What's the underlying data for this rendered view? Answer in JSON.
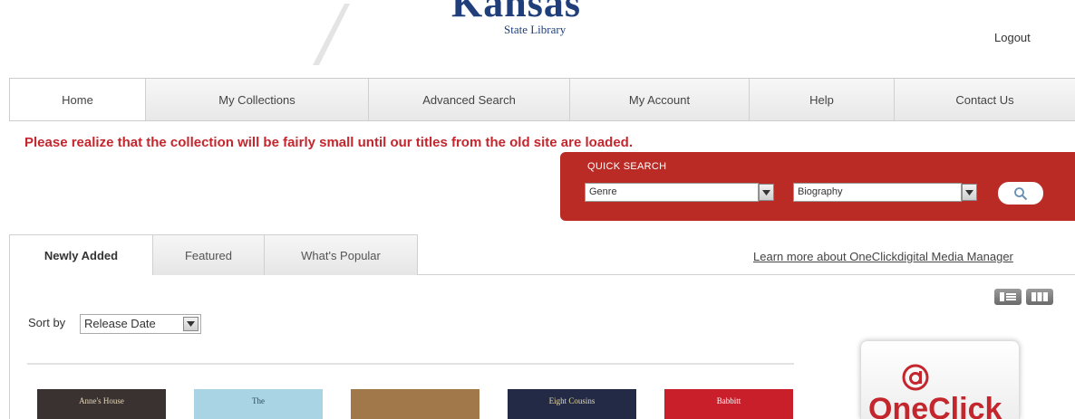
{
  "header": {
    "logo_word": "Kansas",
    "logo_sub": "State Library",
    "logout_label": "Logout"
  },
  "nav": {
    "items": [
      {
        "label": "Home",
        "active": true
      },
      {
        "label": "My Collections"
      },
      {
        "label": "Advanced Search"
      },
      {
        "label": "My Account"
      },
      {
        "label": "Help"
      },
      {
        "label": "Contact Us"
      }
    ]
  },
  "notice": "Please realize that the collection will be fairly small until our titles from the old site are loaded.",
  "quick_search": {
    "title": "QUICK SEARCH",
    "field_value": "Genre",
    "term_value": "Biography",
    "search_icon": "search-icon"
  },
  "tabs": [
    {
      "label": "Newly Added",
      "active": true
    },
    {
      "label": "Featured"
    },
    {
      "label": "What's Popular"
    }
  ],
  "learn_more_link": "Learn more about OneClickdigital Media Manager",
  "sort": {
    "label": "Sort by",
    "value": "Release Date"
  },
  "view_toggles": [
    "list-view-icon",
    "grid-view-icon"
  ],
  "books": [
    {
      "title": "Anne's House",
      "bg": "#3a3230",
      "fg": "#e8d8b8"
    },
    {
      "title": "The",
      "bg": "#a9d4e3",
      "fg": "#2c4a60"
    },
    {
      "title": "",
      "bg": "#a0784a",
      "fg": "#fff"
    },
    {
      "title": "Eight Cousins",
      "bg": "#232a45",
      "fg": "#e6d9a8"
    },
    {
      "title": "Babbitt",
      "bg": "#c81f2b",
      "fg": "#fff"
    }
  ],
  "promo": {
    "logo_text": "OneClick",
    "icon": "oneclick-logo-icon"
  },
  "colors": {
    "accent_red": "#c4262e",
    "quick_search_bg": "#b92b24",
    "logo_blue": "#1f3e7a"
  }
}
